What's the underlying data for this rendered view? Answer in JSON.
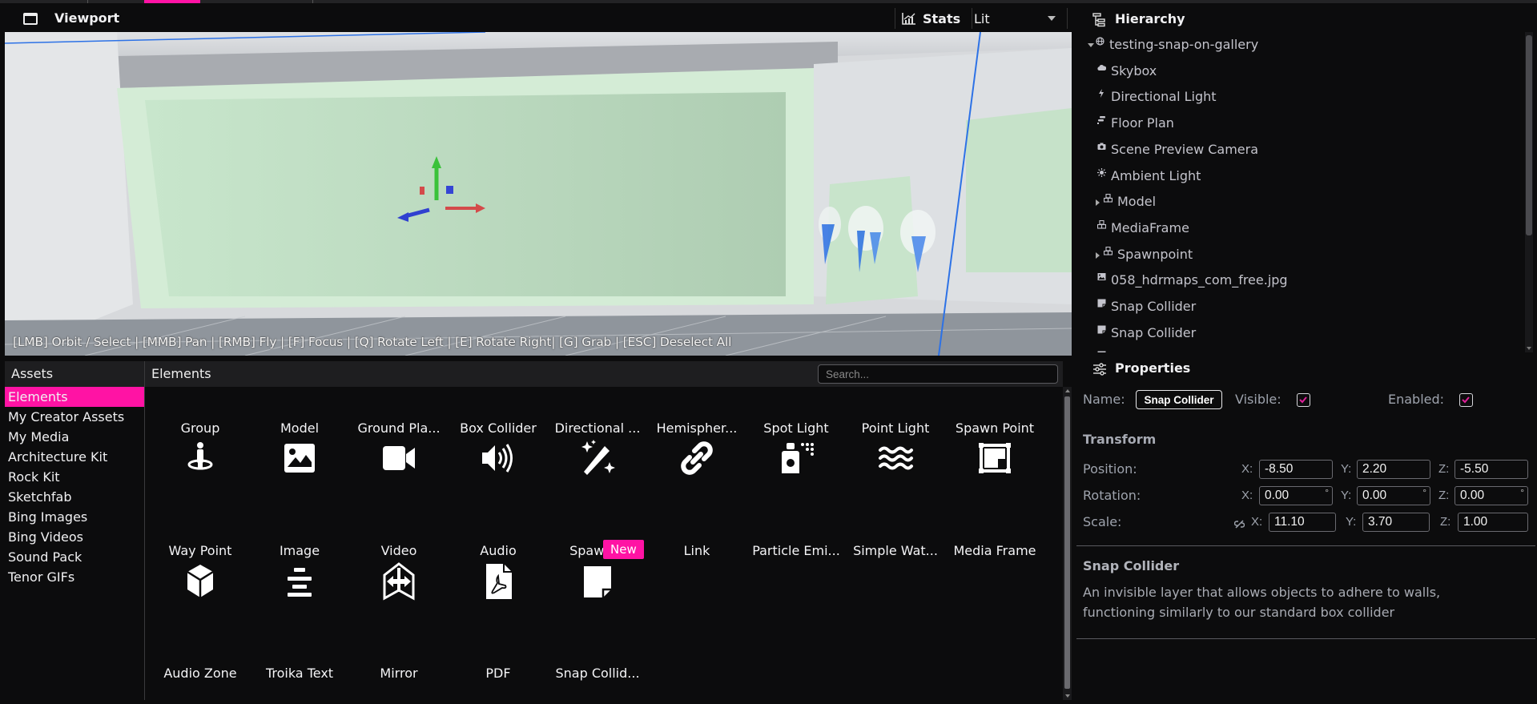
{
  "colors": {
    "accent": "#ff13a4",
    "background": "#0c0c0d",
    "panel_header": "#1e1e20"
  },
  "viewport": {
    "title": "Viewport",
    "title_icon": "window-icon",
    "stats_label": "Stats",
    "stats_icon": "chart-icon",
    "render_mode": "Lit",
    "controls_hint": "[LMB] Orbit / Select | [MMB] Pan | [RMB] Fly | [F] Focus | [Q] Rotate Left | [E] Rotate Right| [G] Grab | [ESC] Deselect All"
  },
  "hierarchy": {
    "title": "Hierarchy",
    "icon": "hierarchy-icon",
    "items": [
      {
        "label": "testing-snap-on-gallery",
        "icon": "globe-icon",
        "expander": "expanded"
      },
      {
        "label": "Skybox",
        "icon": "cloud-icon"
      },
      {
        "label": "Directional Light",
        "icon": "bolt-icon"
      },
      {
        "label": "Floor Plan",
        "icon": "floorplan-icon"
      },
      {
        "label": "Scene Preview Camera",
        "icon": "camera-icon"
      },
      {
        "label": "Ambient Light",
        "icon": "sun-icon"
      },
      {
        "label": "Model",
        "icon": "cubes-icon",
        "expander": "collapsed"
      },
      {
        "label": "MediaFrame",
        "icon": "cubes-icon"
      },
      {
        "label": "Spawnpoint",
        "icon": "cubes-icon",
        "expander": "collapsed"
      },
      {
        "label": "058_hdrmaps_com_free.jpg",
        "icon": "image-icon"
      },
      {
        "label": "Snap Collider",
        "icon": "note-icon"
      },
      {
        "label": "Snap Collider",
        "icon": "note-icon"
      },
      {
        "label": "Snap Collider",
        "icon": "note-icon"
      }
    ]
  },
  "properties": {
    "title": "Properties",
    "icon": "sliders-icon",
    "name_label": "Name:",
    "name_value": "Snap Collider",
    "visible_label": "Visible:",
    "visible_checked": true,
    "enabled_label": "Enabled:",
    "enabled_checked": true,
    "transform_title": "Transform",
    "position_label": "Position:",
    "rotation_label": "Rotation:",
    "scale_label": "Scale:",
    "axis_x": "X:",
    "axis_y": "Y:",
    "axis_z": "Z:",
    "degree": "°",
    "position": {
      "x": "-8.50",
      "y": "2.20",
      "z": "-5.50"
    },
    "rotation": {
      "x": "0.00",
      "y": "0.00",
      "z": "0.00"
    },
    "scale": {
      "x": "11.10",
      "y": "3.70",
      "z": "1.00"
    },
    "scale_link_icon": "unlink-icon",
    "component_title": "Snap Collider",
    "component_description": "An invisible layer that allows objects to adhere to walls, functioning similarly to our standard box collider"
  },
  "assets": {
    "title": "Assets",
    "items": [
      {
        "label": "Elements",
        "active": true
      },
      {
        "label": "My Creator Assets"
      },
      {
        "label": "My Media"
      },
      {
        "label": "Architecture Kit"
      },
      {
        "label": "Rock Kit"
      },
      {
        "label": "Sketchfab"
      },
      {
        "label": "Bing Images"
      },
      {
        "label": "Bing Videos"
      },
      {
        "label": "Sound Pack"
      },
      {
        "label": "Tenor GIFs"
      }
    ]
  },
  "elements": {
    "title": "Elements",
    "search_placeholder": "Search...",
    "new_badge": "New",
    "rows": [
      [
        {
          "label": "Group",
          "icon": "group-icon"
        },
        {
          "label": "Model",
          "icon": "model-icon"
        },
        {
          "label": "Ground Pla...",
          "icon": "ground-plane-icon"
        },
        {
          "label": "Box Collider",
          "icon": "box-collider-icon"
        },
        {
          "label": "Directional ...",
          "icon": "directional-light-icon"
        },
        {
          "label": "Hemispher...",
          "icon": "hemisphere-light-icon"
        },
        {
          "label": "Spot Light",
          "icon": "spot-light-icon"
        },
        {
          "label": "Point Light",
          "icon": "point-light-icon"
        },
        {
          "label": "Spawn Point",
          "icon": "spawn-point-icon"
        }
      ],
      [
        {
          "label": "Way Point",
          "icon": "waypoint-icon"
        },
        {
          "label": "Image",
          "icon": "image-icon"
        },
        {
          "label": "Video",
          "icon": "video-icon"
        },
        {
          "label": "Audio",
          "icon": "audio-icon"
        },
        {
          "label": "Spawner",
          "icon": "magic-wand-icon"
        },
        {
          "label": "Link",
          "icon": "link-icon"
        },
        {
          "label": "Particle Emi...",
          "icon": "spray-icon"
        },
        {
          "label": "Simple Wat...",
          "icon": "water-icon"
        },
        {
          "label": "Media Frame",
          "icon": "media-frame-icon"
        }
      ],
      [
        {
          "label": "Audio Zone",
          "icon": "cube-icon"
        },
        {
          "label": "Troika Text",
          "icon": "align-center-icon"
        },
        {
          "label": "Mirror",
          "icon": "mirror-icon"
        },
        {
          "label": "PDF",
          "icon": "pdf-icon"
        },
        {
          "label": "Snap Collid...",
          "icon": "note-icon",
          "is_new": true
        }
      ]
    ]
  }
}
